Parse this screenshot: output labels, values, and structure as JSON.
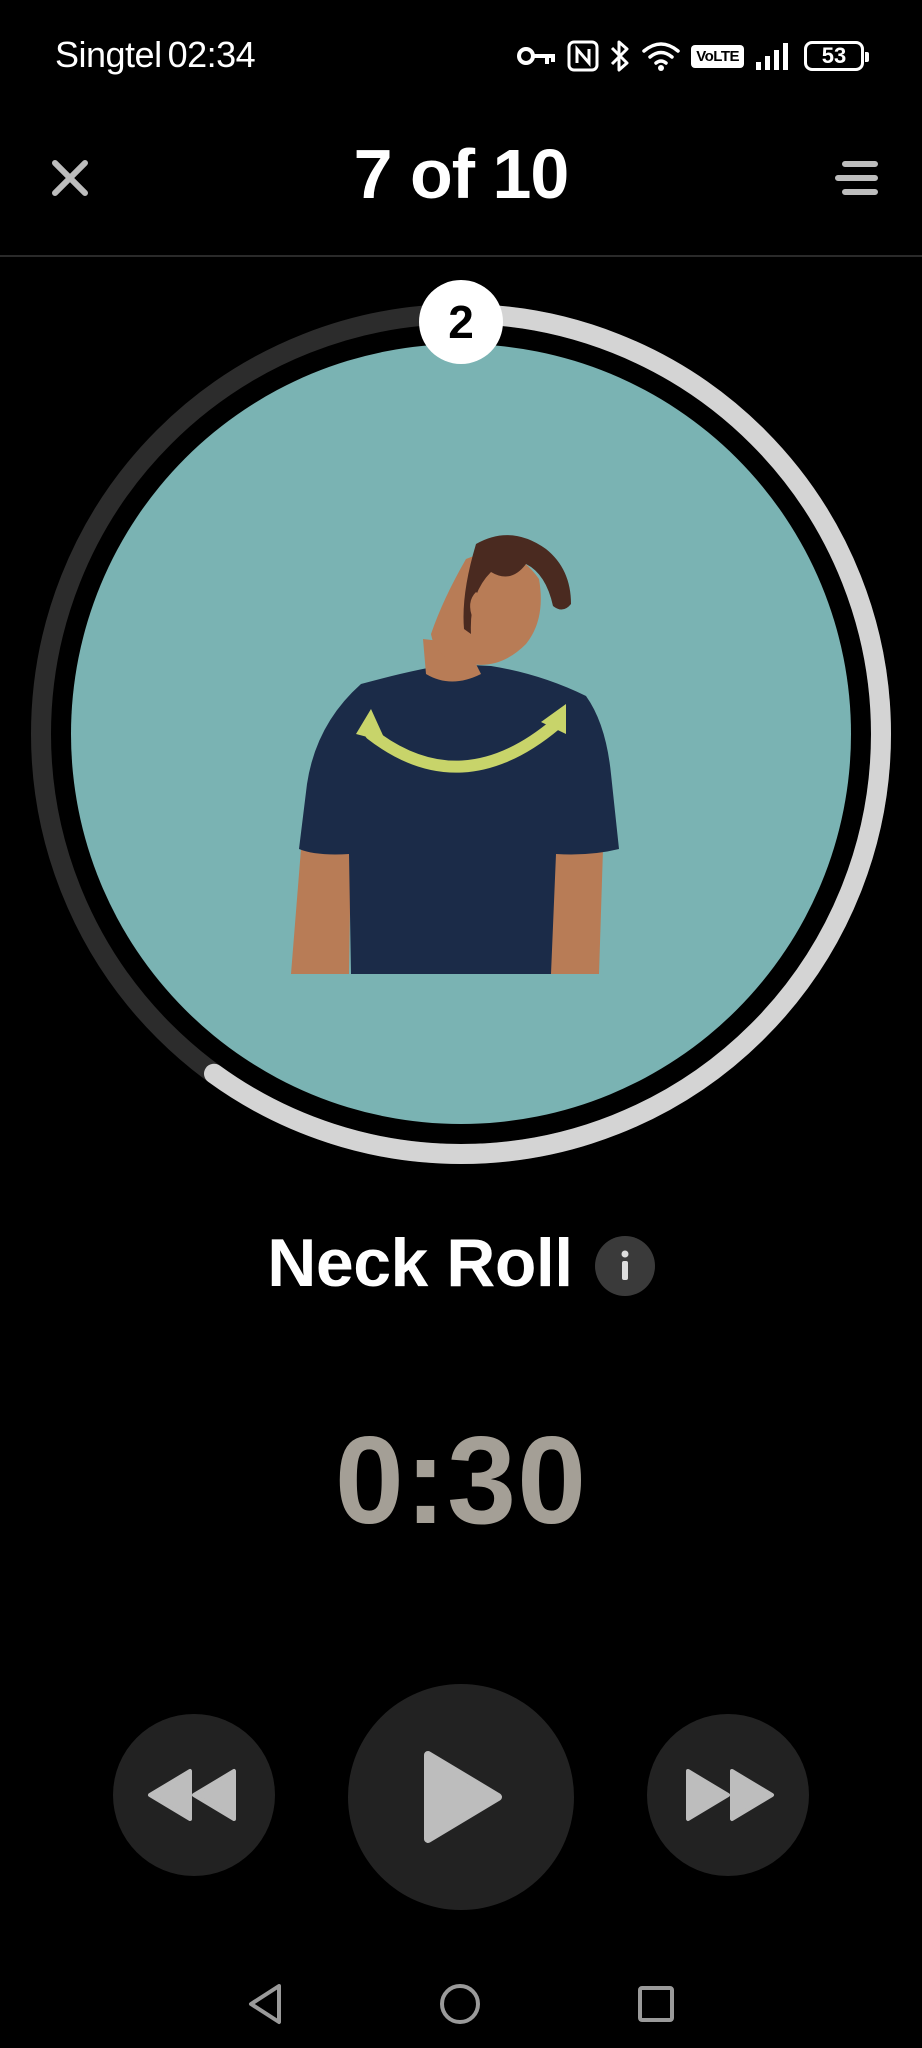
{
  "status_bar": {
    "carrier": "Singtel",
    "time": "02:34",
    "volte_label": "VoLTE",
    "battery": "53",
    "icons": [
      "key-icon",
      "nfc-icon",
      "bluetooth-icon",
      "wifi-icon",
      "volte-icon",
      "signal-icon",
      "battery-icon"
    ]
  },
  "header": {
    "title": "7 of 10",
    "close_icon": "close-icon",
    "list_icon": "exercise-list-icon"
  },
  "exercise": {
    "set_number": "2",
    "name": "Neck Roll",
    "info_icon": "info-icon",
    "progress_fraction": 0.6,
    "image_background": "#7ab3b3"
  },
  "timer": {
    "value": "0:30"
  },
  "controls": {
    "rewind_icon": "rewind-icon",
    "play_icon": "play-icon",
    "forward_icon": "fast-forward-icon"
  },
  "nav_bar": {
    "back_icon": "back-icon",
    "home_icon": "home-icon",
    "recents_icon": "recents-icon"
  },
  "colors": {
    "background": "#000000",
    "ring_progress": "#d4d4d4",
    "ring_track": "#2c2c2c",
    "timer_text": "#a49f96",
    "control_bg": "#222222",
    "icon_gray": "#bdbdbd"
  }
}
